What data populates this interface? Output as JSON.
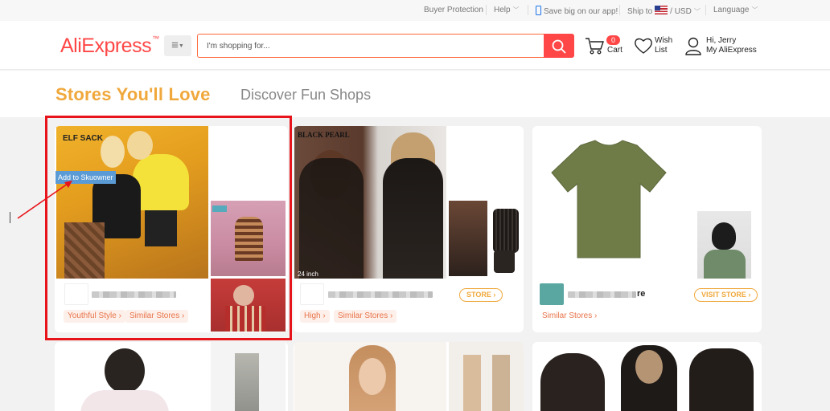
{
  "topbar": {
    "buyer_protection": "Buyer Protection",
    "help": "Help",
    "app_promo": "Save big on our app!",
    "ship_to": "Ship to",
    "currency": "/ USD",
    "language": "Language"
  },
  "header": {
    "logo": "AliExpress",
    "search_placeholder": "I'm shopping for...",
    "cart_count": "0",
    "cart_label": "Cart",
    "wish_line1": "Wish",
    "wish_line2": "List",
    "account_line1": "Hi, Jerry",
    "account_line2": "My AliExpress"
  },
  "page": {
    "title": "Stores You'll Love",
    "subtitle": "Discover Fun Shops"
  },
  "stores": [
    {
      "banner_text": "ELF SACK",
      "overlay_button": "Add to Skuowner",
      "tags": [
        "Youthful Style ›",
        "Similar Stores ›"
      ]
    },
    {
      "banner_text": "BLACK PEARL",
      "image_caption": "24 inch",
      "visit_label": "STORE ›",
      "tags": [
        "High ›",
        "Similar Stores ›"
      ]
    },
    {
      "name_suffix": "re",
      "visit_label": "VISIT STORE ›",
      "tags": [
        "Similar Stores ›"
      ]
    }
  ],
  "colors": {
    "brand_red": "#ff4747",
    "title_orange": "#f0a83c",
    "highlight_red": "#e8141b",
    "tag_text": "#e8734a"
  }
}
